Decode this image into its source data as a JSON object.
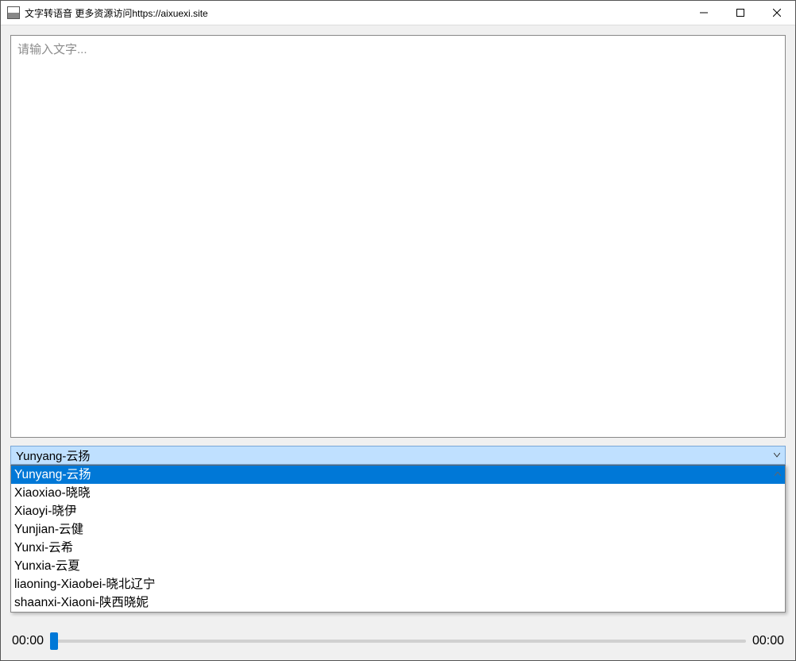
{
  "window": {
    "title": "文字转语音  更多资源访问https://aixuexi.site"
  },
  "textarea": {
    "placeholder": "请输入文字..."
  },
  "voiceSelect": {
    "selected": "Yunyang-云扬",
    "options": [
      "Yunyang-云扬",
      "Xiaoxiao-晓晓",
      "Xiaoyi-晓伊",
      "Yunjian-云健",
      "Yunxi-云希",
      "Yunxia-云夏",
      "liaoning-Xiaobei-晓北辽宁",
      "shaanxi-Xiaoni-陕西晓妮"
    ]
  },
  "player": {
    "currentTime": "00:00",
    "totalTime": "00:00"
  },
  "colors": {
    "accent": "#0078d7",
    "comboBg": "#bfe0ff"
  }
}
